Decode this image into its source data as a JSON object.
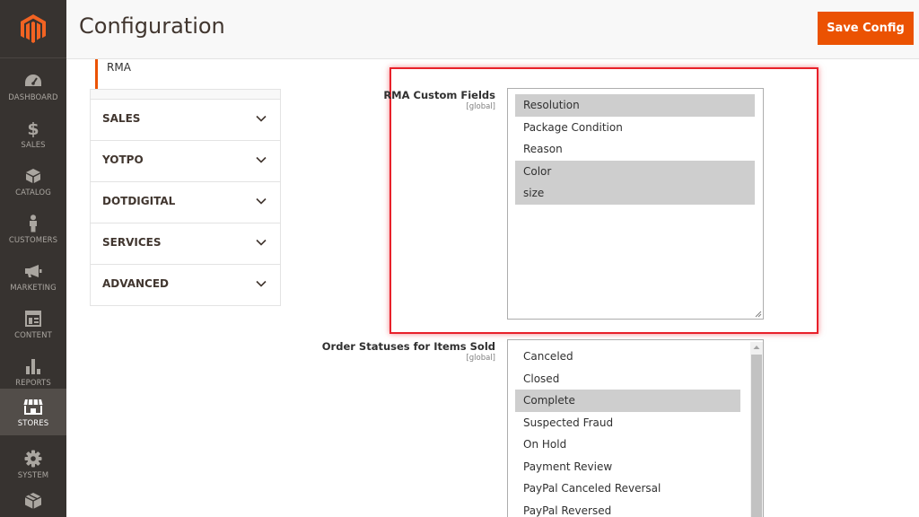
{
  "nav": {
    "items": [
      {
        "label": "DASHBOARD",
        "icon": "dashboard-icon"
      },
      {
        "label": "SALES",
        "icon": "dollar-icon"
      },
      {
        "label": "CATALOG",
        "icon": "cube-icon"
      },
      {
        "label": "CUSTOMERS",
        "icon": "person-icon"
      },
      {
        "label": "MARKETING",
        "icon": "megaphone-icon"
      },
      {
        "label": "CONTENT",
        "icon": "layout-icon"
      },
      {
        "label": "REPORTS",
        "icon": "bar-chart-icon"
      },
      {
        "label": "STORES",
        "icon": "store-icon"
      },
      {
        "label": "SYSTEM",
        "icon": "gear-icon"
      }
    ],
    "active": "STORES"
  },
  "header": {
    "title": "Configuration",
    "save_label": "Save Config"
  },
  "tabs": {
    "current_item": "RMA",
    "groups": [
      {
        "label": "SALES"
      },
      {
        "label": "YOTPO"
      },
      {
        "label": "DOTDIGITAL"
      },
      {
        "label": "SERVICES"
      },
      {
        "label": "ADVANCED"
      }
    ]
  },
  "fields": {
    "rma_custom_fields": {
      "label": "RMA Custom Fields",
      "scope": "[global]",
      "options": [
        {
          "text": "Resolution",
          "selected": true
        },
        {
          "text": "Package Condition",
          "selected": false
        },
        {
          "text": "Reason",
          "selected": false
        },
        {
          "text": "Color",
          "selected": true
        },
        {
          "text": "size",
          "selected": true
        }
      ]
    },
    "order_statuses": {
      "label": "Order Statuses for Items Sold",
      "scope": "[global]",
      "options": [
        {
          "text": "Canceled",
          "selected": false
        },
        {
          "text": "Closed",
          "selected": false
        },
        {
          "text": "Complete",
          "selected": true
        },
        {
          "text": "Suspected Fraud",
          "selected": false
        },
        {
          "text": "On Hold",
          "selected": false
        },
        {
          "text": "Payment Review",
          "selected": false
        },
        {
          "text": "PayPal Canceled Reversal",
          "selected": false
        },
        {
          "text": "PayPal Reversed",
          "selected": false
        }
      ]
    }
  },
  "colors": {
    "accent": "#eb5202",
    "sidebar": "#373330",
    "highlight": "#e8202a",
    "selected_option": "#cecece"
  }
}
